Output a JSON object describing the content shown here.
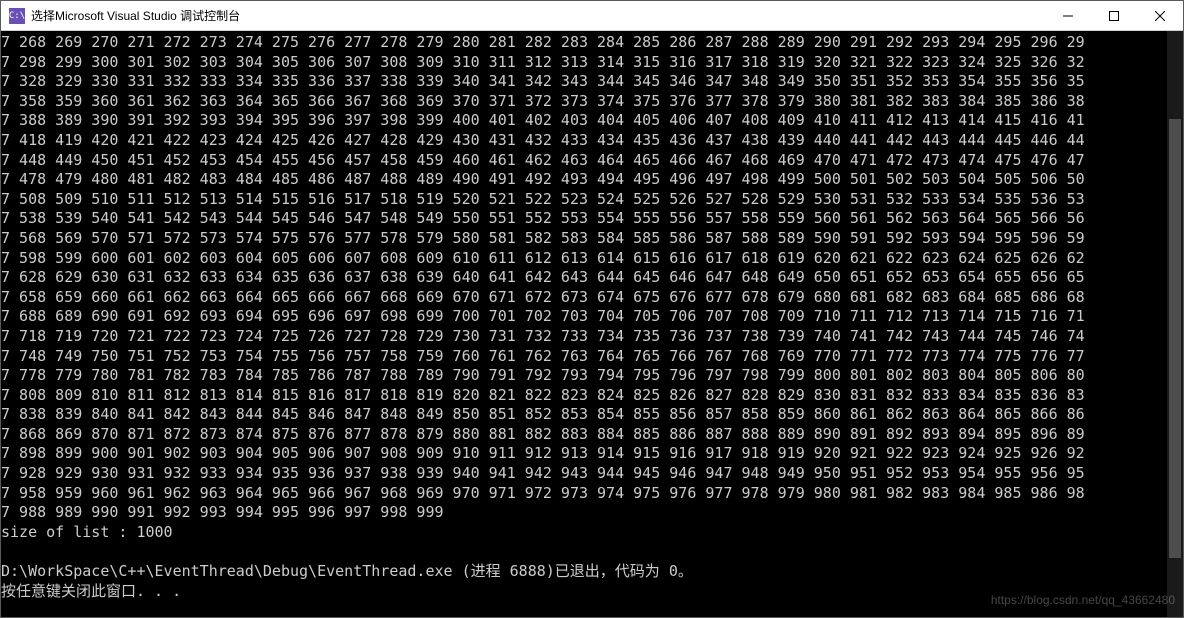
{
  "window": {
    "title": "选择Microsoft Visual Studio 调试控制台",
    "icon_label": "C:\\"
  },
  "console": {
    "rows": [
      {
        "prefix": "7",
        "start": 268,
        "end": 296,
        "tail": " 29"
      },
      {
        "prefix": "7",
        "start": 298,
        "end": 326,
        "tail": " 32"
      },
      {
        "prefix": "7",
        "start": 328,
        "end": 356,
        "tail": " 35"
      },
      {
        "prefix": "7",
        "start": 358,
        "end": 386,
        "tail": " 38"
      },
      {
        "prefix": "7",
        "start": 388,
        "end": 416,
        "tail": " 41"
      },
      {
        "prefix": "7",
        "start": 418,
        "end": 446,
        "tail": " 44"
      },
      {
        "prefix": "7",
        "start": 448,
        "end": 476,
        "tail": " 47"
      },
      {
        "prefix": "7",
        "start": 478,
        "end": 506,
        "tail": " 50"
      },
      {
        "prefix": "7",
        "start": 508,
        "end": 536,
        "tail": " 53"
      },
      {
        "prefix": "7",
        "start": 538,
        "end": 566,
        "tail": " 56"
      },
      {
        "prefix": "7",
        "start": 568,
        "end": 596,
        "tail": " 59"
      },
      {
        "prefix": "7",
        "start": 598,
        "end": 626,
        "tail": " 62"
      },
      {
        "prefix": "7",
        "start": 628,
        "end": 656,
        "tail": " 65"
      },
      {
        "prefix": "7",
        "start": 658,
        "end": 686,
        "tail": " 68"
      },
      {
        "prefix": "7",
        "start": 688,
        "end": 716,
        "tail": " 71"
      },
      {
        "prefix": "7",
        "start": 718,
        "end": 746,
        "tail": " 74"
      },
      {
        "prefix": "7",
        "start": 748,
        "end": 776,
        "tail": " 77"
      },
      {
        "prefix": "7",
        "start": 778,
        "end": 806,
        "tail": " 80"
      },
      {
        "prefix": "7",
        "start": 808,
        "end": 836,
        "tail": " 83"
      },
      {
        "prefix": "7",
        "start": 838,
        "end": 866,
        "tail": " 86"
      },
      {
        "prefix": "7",
        "start": 868,
        "end": 896,
        "tail": " 89"
      },
      {
        "prefix": "7",
        "start": 898,
        "end": 926,
        "tail": " 92"
      },
      {
        "prefix": "7",
        "start": 928,
        "end": 956,
        "tail": " 95"
      },
      {
        "prefix": "7",
        "start": 958,
        "end": 986,
        "tail": " 98"
      },
      {
        "prefix": "7",
        "start": 988,
        "end": 999,
        "tail": ""
      }
    ],
    "size_line": "size of list : 1000",
    "blank_line": "",
    "exit_line": "D:\\WorkSpace\\C++\\EventThread\\Debug\\EventThread.exe (进程 6888)已退出，代码为 0。",
    "prompt_line": "按任意键关闭此窗口. . ."
  },
  "watermark": "https://blog.csdn.net/qq_43662480"
}
